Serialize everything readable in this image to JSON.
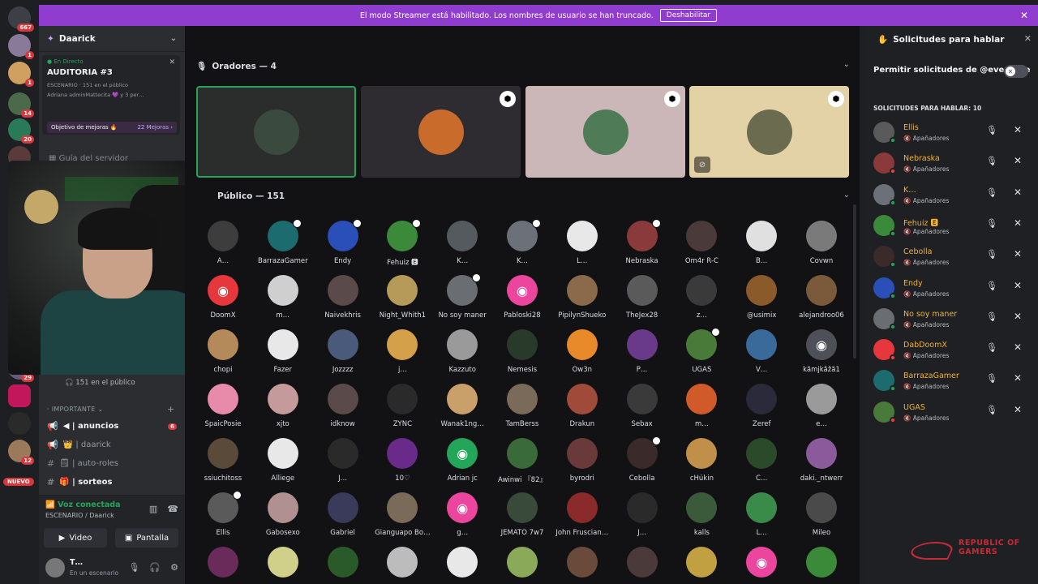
{
  "rail": {
    "home_badge": "667",
    "nuevo": "NUEVO",
    "badges": [
      "1",
      "1",
      "14",
      "20",
      "1",
      "",
      "29",
      "",
      "",
      "12"
    ]
  },
  "banner": {
    "text": "El modo Streamer está habilitado. Los nombres de usuario se han truncado.",
    "button": "Deshabilitar",
    "close": "✕"
  },
  "sidebar": {
    "server_name": "Daarick",
    "live_tag": "● En Directo",
    "event_title": "AUDITORIA #3",
    "event_meta": "ESCENARIO · 151 en el público",
    "event_users": "Adriana adminMattecita 💜 y 3 per…",
    "goal_label": "Objetivo de mejoras 🔥",
    "goal_value": "22 Mejoras ›",
    "guide": "Guía del servidor",
    "audience_count": "151 en el público",
    "category": "IMPORTANTE",
    "channels": [
      {
        "name": "anuncios",
        "prefix": "📢 ◀ |",
        "count": "6",
        "bold": true
      },
      {
        "name": "daarick",
        "prefix": "👑 |",
        "bold": false
      },
      {
        "name": "auto-roles",
        "prefix": "🗒 |",
        "bold": false
      },
      {
        "name": "sorteos",
        "prefix": "🎁 |",
        "bold": true
      }
    ]
  },
  "voice": {
    "title": "Voz conectada",
    "subtitle": "ESCENARIO / Daarick",
    "video_label": "Video",
    "screen_label": "Pantalla"
  },
  "user": {
    "name": "T…",
    "status": "En un escenario"
  },
  "main": {
    "speakers_header": "Oradores — 4",
    "audience_header": "Público — 151",
    "speakers": [
      {
        "color": "#3b4a3e",
        "bg": "#2a2d2b",
        "mod": false
      },
      {
        "color": "#c96b2a",
        "bg": "#2e2c31",
        "mod": true
      },
      {
        "color": "#4f7b56",
        "bg": "#cbb7b7",
        "mod": true
      },
      {
        "color": "#6b6b4f",
        "bg": "#e3d2a6",
        "mod": true,
        "muted": true
      }
    ],
    "audience": [
      {
        "name": "A…",
        "color": "#3d3d3d"
      },
      {
        "name": "BarrazaGamer",
        "color": "#1c6b6e",
        "mod": true
      },
      {
        "name": "Endy",
        "color": "#2a4fb8",
        "mod": true
      },
      {
        "name": "Fehuiz 🅴",
        "color": "#3a8a3a",
        "mod": true
      },
      {
        "name": "K…",
        "color": "#555a5e"
      },
      {
        "name": "K…",
        "color": "#6c7179",
        "mod": true
      },
      {
        "name": "L…",
        "color": "#e8e8e8"
      },
      {
        "name": "Nebraska",
        "color": "#8a3a3a",
        "mod": true
      },
      {
        "name": "Om4r R-C",
        "color": "#4a3a3a"
      },
      {
        "name": "B…",
        "color": "#e0e0e0"
      },
      {
        "name": "Covwn",
        "color": "#7a7a7a"
      },
      {
        "name": "DoomX",
        "color": "#e5373c",
        "discord": true
      },
      {
        "name": "m…",
        "color": "#cfcfcf"
      },
      {
        "name": "Naivekhris",
        "color": "#5a4a4a"
      },
      {
        "name": "Night_Whith1",
        "color": "#b59a5a"
      },
      {
        "name": "No soy maner",
        "color": "#6a6e73",
        "mod": true
      },
      {
        "name": "Pabloski28",
        "color": "#eb459e",
        "discord": true
      },
      {
        "name": "PipilynShueko",
        "color": "#8a6a4a"
      },
      {
        "name": "TheJex28",
        "color": "#5a5a5a"
      },
      {
        "name": "z…",
        "color": "#3a3a3a"
      },
      {
        "name": "@usimix",
        "color": "#8a5a2a"
      },
      {
        "name": "alejandroo06",
        "color": "#7a5a3a"
      },
      {
        "name": "chopi",
        "color": "#b58a5a"
      },
      {
        "name": "Fazer",
        "color": "#e8e8e8"
      },
      {
        "name": "Jozzzz",
        "color": "#4a5a7a"
      },
      {
        "name": "j…",
        "color": "#d4a04a"
      },
      {
        "name": "Kazzuto",
        "color": "#9a9a9a"
      },
      {
        "name": "Nemesis",
        "color": "#2a3a2a"
      },
      {
        "name": "Ow3n",
        "color": "#e88a2a"
      },
      {
        "name": "P…",
        "color": "#6a3a8a"
      },
      {
        "name": "UGAS",
        "color": "#4a7a3a",
        "mod": true
      },
      {
        "name": "V…",
        "color": "#3a6a9a"
      },
      {
        "name": "kåmjkåžå1",
        "color": "#4e5058",
        "discord": true
      },
      {
        "name": "SpaicPosie",
        "color": "#e88aaa"
      },
      {
        "name": "xjto",
        "color": "#c49a9a"
      },
      {
        "name": "idknow",
        "color": "#5a4a4a"
      },
      {
        "name": "ZYNC",
        "color": "#2a2a2a"
      },
      {
        "name": "Wanak1ng…",
        "color": "#c9a06a"
      },
      {
        "name": "TamBerss",
        "color": "#7a6a5a"
      },
      {
        "name": "Drakun",
        "color": "#a04a3a"
      },
      {
        "name": "Sebax",
        "color": "#3a3a3a"
      },
      {
        "name": "m…",
        "color": "#d05a2a"
      },
      {
        "name": "Zeref",
        "color": "#2a2a3a"
      },
      {
        "name": "e…",
        "color": "#9a9a9a"
      },
      {
        "name": "ssiuchitoss",
        "color": "#5a4a3a"
      },
      {
        "name": "Alliege",
        "color": "#e8e8e8"
      },
      {
        "name": "J…",
        "color": "#2a2a2a"
      },
      {
        "name": "10♡",
        "color": "#6a2a8a"
      },
      {
        "name": "Adrian jc",
        "color": "#23a55a",
        "discord": true
      },
      {
        "name": "Awinwi 『82』",
        "color": "#3a6a3a"
      },
      {
        "name": "byrodri",
        "color": "#6a3a3a"
      },
      {
        "name": "Cebolla",
        "color": "#3a2a2a",
        "mod": true
      },
      {
        "name": "cHúkin",
        "color": "#c0904a"
      },
      {
        "name": "C…",
        "color": "#2a4a2a"
      },
      {
        "name": "daki._ntwerr",
        "color": "#8a5a9a"
      },
      {
        "name": "Ellis",
        "color": "#5a5a5a",
        "mod": true
      },
      {
        "name": "Gabosexo",
        "color": "#b09090"
      },
      {
        "name": "Gabriel",
        "color": "#3a3a5a"
      },
      {
        "name": "Gianguapo Bo…",
        "color": "#7a6a5a"
      },
      {
        "name": "g…",
        "color": "#eb459e",
        "discord": true
      },
      {
        "name": "JEMATO 7w7",
        "color": "#3a4a3a"
      },
      {
        "name": "John Fruscian…",
        "color": "#8a2a2a"
      },
      {
        "name": "J…",
        "color": "#2a2a2a"
      },
      {
        "name": "kalls",
        "color": "#3a5a3a"
      },
      {
        "name": "L…",
        "color": "#3a8a4a"
      },
      {
        "name": "Mileo",
        "color": "#4a4a4a"
      },
      {
        "name": "",
        "color": "#6a2a5a"
      },
      {
        "name": "",
        "color": "#d0d08a"
      },
      {
        "name": "",
        "color": "#2a5a2a"
      },
      {
        "name": "",
        "color": "#bcbcbc"
      },
      {
        "name": "",
        "color": "#e8e8e8"
      },
      {
        "name": "",
        "color": "#8aaa5a"
      },
      {
        "name": "",
        "color": "#6a4a3a"
      },
      {
        "name": "",
        "color": "#4a3a3a"
      },
      {
        "name": "",
        "color": "#c0a040"
      },
      {
        "name": "",
        "color": "#eb459e",
        "discord": true
      },
      {
        "name": "",
        "color": "#3a8a3a"
      }
    ]
  },
  "rpanel": {
    "title": "Solicitudes para hablar",
    "permission": "Permitir solicitudes de @everyone",
    "count_label": "SOLICITUDES PARA HABLAR: 10",
    "requests": [
      {
        "name": "Ellis",
        "sub": "🔇 Apañadores",
        "color": "#5a5a5a"
      },
      {
        "name": "Nebraska",
        "sub": "🔇 Apañadores",
        "color": "#8a3a3a"
      },
      {
        "name": "K…",
        "sub": "🔇 Apañadores",
        "color": "#6c7179"
      },
      {
        "name": "Fehuiz 🅴",
        "sub": "🔇 Apañadores",
        "color": "#3a8a3a"
      },
      {
        "name": "Cebolla",
        "sub": "🔇 Apañadores",
        "color": "#3a2a2a"
      },
      {
        "name": "Endy",
        "sub": "🔇 Apañadores",
        "color": "#2a4fb8"
      },
      {
        "name": "No soy maner",
        "sub": "🔇 Apañadores",
        "color": "#6a6e73"
      },
      {
        "name": "DabDoomX",
        "sub": "🔇 Apañadores",
        "color": "#e5373c"
      },
      {
        "name": "BarrazaGamer",
        "sub": "🔇 Apañadores",
        "color": "#1c6b6e"
      },
      {
        "name": "UGAS",
        "sub": "🔇 Apañadores",
        "color": "#4a7a3a"
      }
    ]
  },
  "branding": {
    "line1": "REPUBLIC OF",
    "line2": "GAMERS"
  }
}
